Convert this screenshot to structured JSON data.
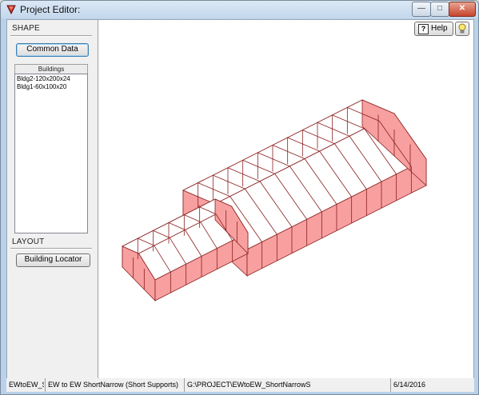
{
  "window": {
    "title": "Project Editor:",
    "minimize_label": "—",
    "maximize_label": "□",
    "close_label": "✕"
  },
  "left_panel": {
    "shape_label": "SHAPE",
    "common_data_button": "Common Data",
    "buildings_header": "Buildings",
    "buildings": [
      "Bldg2-120x200x24",
      "Bldg1-60x100x20"
    ],
    "layout_label": "LAYOUT",
    "building_locator_button": "Building Locator"
  },
  "toolbar": {
    "help_label": "Help",
    "help_icon_glyph": "?",
    "bulb_icon": "lightbulb-icon"
  },
  "statusbar": {
    "file": "EWtoEW_Sh",
    "description": "EW to EW ShortNarrow (Short Supports)",
    "path": "G:\\PROJECT\\EWtoEW_ShortNarrowS",
    "date": "6/14/2016"
  },
  "colors": {
    "wall_fill": "#f8a0a0",
    "wall_stroke": "#8a1f1f",
    "roof_fill": "#ffffff"
  }
}
